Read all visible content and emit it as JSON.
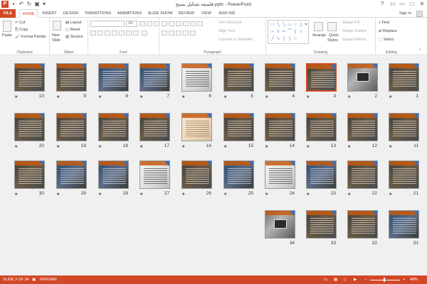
{
  "window": {
    "title": "فلسفه تشکیل بسیج.pptx - PowerPoint",
    "help": "?",
    "minimize": "—",
    "maximize": "□",
    "close": "✕"
  },
  "tabs": [
    "FILE",
    "HOME",
    "INSERT",
    "DESIGN",
    "TRANSITIONS",
    "ANIMATIONS",
    "SLIDE SHOW",
    "REVIEW",
    "VIEW",
    "ADD-INS"
  ],
  "signin": "Sign in",
  "ribbon": {
    "clipboard": {
      "paste": "Paste",
      "cut": "Cut",
      "copy": "Copy",
      "format_painter": "Format Painter",
      "label": "Clipboard"
    },
    "slides": {
      "new_slide": "New",
      "new_slide_2": "Slide",
      "layout": "Layout",
      "reset": "Reset",
      "section": "Section",
      "label": "Slides"
    },
    "font": {
      "size": "24",
      "label": "Font"
    },
    "paragraph": {
      "text_direction": "Text Direction",
      "align_text": "Align Text",
      "convert_smartart": "Convert to SmartArt",
      "label": "Paragraph"
    },
    "drawing": {
      "arrange": "Arrange",
      "quick_styles": "Quick",
      "quick_styles_2": "Styles",
      "shape_fill": "Shape Fill",
      "shape_outline": "Shape Outline",
      "shape_effects": "Shape Effects",
      "label": "Drawing"
    },
    "editing": {
      "find": "Find",
      "replace": "Replace",
      "select": "Select",
      "label": "Editing"
    }
  },
  "slides": [
    {
      "num": "1",
      "style": "dark"
    },
    {
      "num": "2",
      "style": "photo"
    },
    {
      "num": "3",
      "style": "dark",
      "selected": true
    },
    {
      "num": "4",
      "style": "dark"
    },
    {
      "num": "5",
      "style": "dark"
    },
    {
      "num": "6",
      "style": "white"
    },
    {
      "num": "7",
      "style": "blue"
    },
    {
      "num": "8",
      "style": "blue"
    },
    {
      "num": "9",
      "style": "dark"
    },
    {
      "num": "10",
      "style": "dark"
    },
    {
      "num": "11",
      "style": "dark"
    },
    {
      "num": "12",
      "style": "dark"
    },
    {
      "num": "13",
      "style": "dark"
    },
    {
      "num": "14",
      "style": "dark"
    },
    {
      "num": "15",
      "style": "dark"
    },
    {
      "num": "16",
      "style": "light"
    },
    {
      "num": "17",
      "style": "dark"
    },
    {
      "num": "18",
      "style": "dark"
    },
    {
      "num": "19",
      "style": "dark"
    },
    {
      "num": "20",
      "style": "dark"
    },
    {
      "num": "21",
      "style": "dark"
    },
    {
      "num": "22",
      "style": "dark"
    },
    {
      "num": "23",
      "style": "blue"
    },
    {
      "num": "24",
      "style": "white"
    },
    {
      "num": "25",
      "style": "blue"
    },
    {
      "num": "26",
      "style": "dark"
    },
    {
      "num": "27",
      "style": "white"
    },
    {
      "num": "28",
      "style": "blue"
    },
    {
      "num": "29",
      "style": "blue"
    },
    {
      "num": "30",
      "style": "dark"
    },
    {
      "num": "31",
      "style": "blue"
    },
    {
      "num": "32",
      "style": "dark"
    },
    {
      "num": "33",
      "style": "dark"
    },
    {
      "num": "34",
      "style": "photo"
    }
  ],
  "status": {
    "slide": "SLIDE 3 OF 34",
    "language": "PERSIAN",
    "zoom": "48%",
    "zoom_minus": "−",
    "zoom_plus": "+"
  },
  "colors": {
    "accent": "#d24726",
    "sorter_bg": "#f0f0f0"
  }
}
